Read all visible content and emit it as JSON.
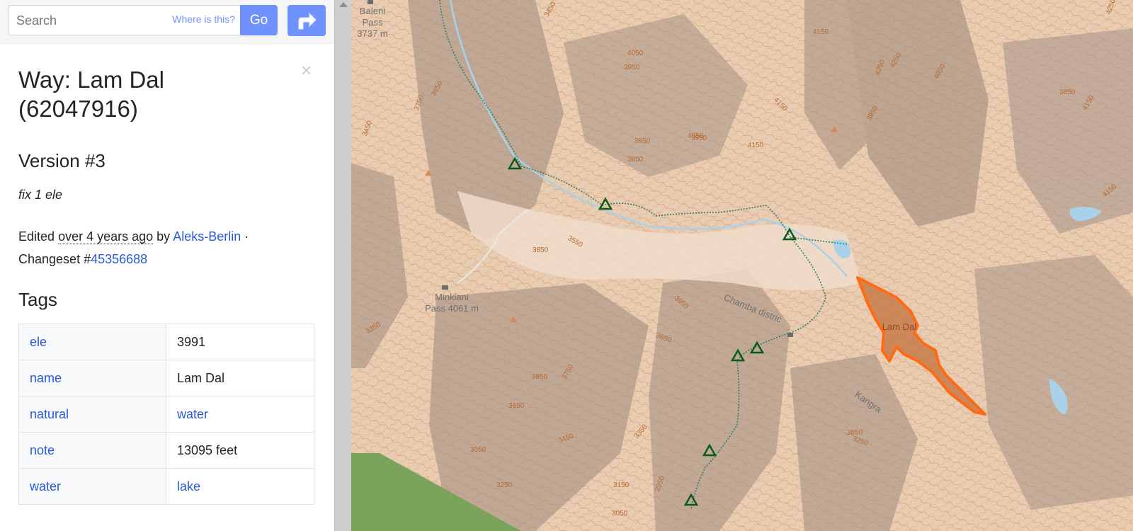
{
  "search": {
    "placeholder": "Search",
    "where_is_this": "Where is this?",
    "go_label": "Go"
  },
  "feature": {
    "title": "Way: Lam Dal (62047916)",
    "version": "Version #3",
    "comment": "fix 1 ele",
    "edited_prefix": "Edited",
    "edited_time": "over 4 years ago",
    "by_label": "by",
    "user": "Aleks-Berlin",
    "separator": "·",
    "changeset_prefix": "Changeset #",
    "changeset": "45356688",
    "tags_title": "Tags",
    "tags": [
      {
        "key": "ele",
        "value": "3991"
      },
      {
        "key": "name",
        "value": "Lam Dal"
      },
      {
        "key": "natural",
        "value": "water"
      },
      {
        "key": "note",
        "value": "13095 feet"
      },
      {
        "key": "water",
        "value": "lake"
      }
    ]
  },
  "map": {
    "labels": {
      "baleni": "Baleni Pass 3737 m",
      "minkiani": "Minkiani Pass 4061 m",
      "lake": "Lam Dal",
      "chamba": "Chamba distric",
      "kangra": "Kangra"
    },
    "contour_labels": [
      "3450",
      "4150",
      "3750",
      "4050",
      "3950",
      "4250",
      "4150",
      "3850",
      "3950",
      "3650",
      "3450",
      "3950",
      "3550",
      "4050",
      "4150",
      "3850",
      "3950",
      "3650",
      "3350",
      "3750",
      "3850",
      "3650",
      "3550",
      "3450",
      "3250",
      "3150",
      "3050",
      "2950",
      "3350",
      "3250",
      "4250",
      "3950",
      "4150",
      "4050",
      "3850",
      "3850",
      "4150",
      "4250"
    ],
    "colors": {
      "highlight": "#ff6a13",
      "lake_fill": "#c87b4a",
      "water": "#a9d2ea",
      "trail": "#2e7d6c",
      "camp": "#0b5a1a",
      "forest": "#7aa35b"
    }
  },
  "icons": {
    "close": "close-icon",
    "directions": "directions-icon",
    "camp": "camp-site-icon"
  }
}
